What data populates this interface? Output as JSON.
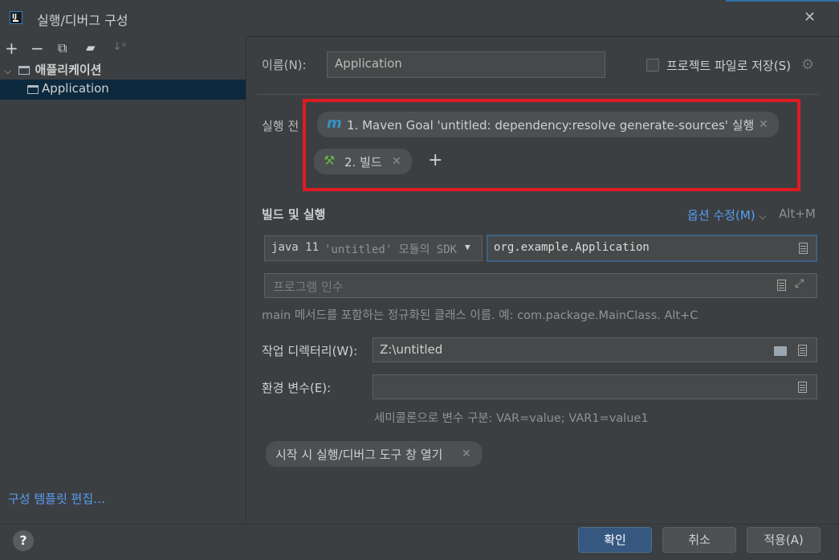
{
  "window": {
    "title": "실행/디버그 구성",
    "close_icon": "close-icon"
  },
  "left": {
    "toolbar": [
      "+",
      "−",
      "⧉",
      "🗀+",
      "↓a"
    ],
    "tree": {
      "parent_label": "애플리케이션",
      "child_label": "Application"
    },
    "edit_templates_link": "구성 템플릿 편집…"
  },
  "form": {
    "name_label": "이름(N):",
    "name_value": "Application",
    "save_to_project_label": "프로젝트 파일로 저장(S)",
    "save_to_project_checked": false,
    "before_launch_label": "실행 전",
    "before_tasks": [
      {
        "prefix": "m",
        "label": "1. Maven Goal 'untitled: dependency:resolve generate-sources' 실행"
      },
      {
        "prefix": "🔨",
        "label": "2. 빌드"
      }
    ],
    "add_task_symbol": "+",
    "build_run_heading": "빌드 및 실행",
    "modify_options_label": "옵션 수정(M)",
    "modify_options_shortcut": "Alt+M",
    "sdk_java": "java 11",
    "sdk_rest": "'untitled' 모듈의 SDK",
    "main_class_value": "org.example.Application",
    "program_args_placeholder": "프로그램 인수",
    "main_class_hint": "main 메서드를 포함하는 정규화된 클래스 이름. 예: com.package.MainClass. Alt+C",
    "workdir_label": "작업 디렉터리(W):",
    "workdir_value": "Z:\\untitled",
    "env_label": "환경 변수(E):",
    "env_value": "",
    "env_hint": "세미콜론으로 변수 구분: VAR=value; VAR1=value1",
    "open_tool_window_chip": "시작 시 실행/디버그 도구 창 열기"
  },
  "footer": {
    "help_label": "?",
    "ok_label": "확인",
    "cancel_label": "취소",
    "apply_label": "적용(A)"
  },
  "colors": {
    "background": "#3c3f41",
    "accent_link": "#589df6",
    "highlight_box": "#e01b24",
    "selection": "#0d293e",
    "primary_button": "#365880"
  }
}
